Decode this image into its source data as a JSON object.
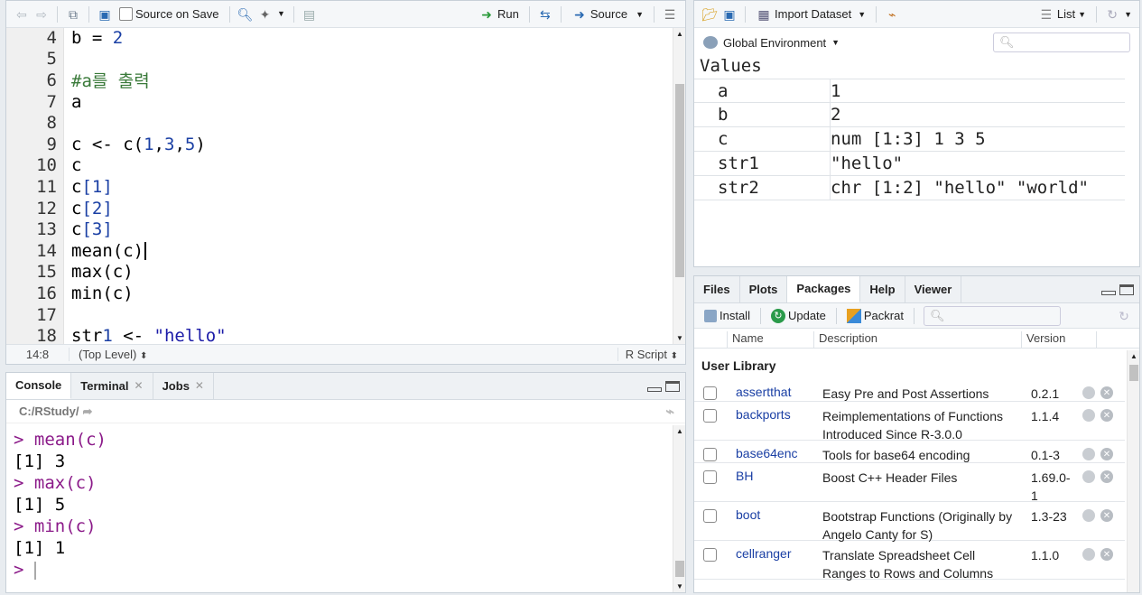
{
  "editor": {
    "toolbar": {
      "source_on_save": "Source on Save",
      "run": "Run",
      "source": "Source"
    },
    "lines": [
      {
        "n": "4",
        "code": "b = 2"
      },
      {
        "n": "5",
        "code": ""
      },
      {
        "n": "6",
        "code": "#a를 출력"
      },
      {
        "n": "7",
        "code": "a"
      },
      {
        "n": "8",
        "code": ""
      },
      {
        "n": "9",
        "code": "c <- c(1,3,5)"
      },
      {
        "n": "10",
        "code": "c"
      },
      {
        "n": "11",
        "code": "c[1]"
      },
      {
        "n": "12",
        "code": "c[2]"
      },
      {
        "n": "13",
        "code": "c[3]"
      },
      {
        "n": "14",
        "code": "mean(c)"
      },
      {
        "n": "15",
        "code": "max(c)"
      },
      {
        "n": "16",
        "code": "min(c)"
      },
      {
        "n": "17",
        "code": ""
      },
      {
        "n": "18",
        "code": "str1 <- \"hello\""
      }
    ],
    "status": {
      "position": "14:8",
      "scope": "(Top Level)",
      "filetype": "R Script"
    }
  },
  "console": {
    "tabs": [
      "Console",
      "Terminal",
      "Jobs"
    ],
    "path": "C:/RStudy/",
    "lines": [
      {
        "kind": "cmd",
        "text": "> mean(c)"
      },
      {
        "kind": "out",
        "text": "[1] 3"
      },
      {
        "kind": "cmd",
        "text": "> max(c)"
      },
      {
        "kind": "out",
        "text": "[1] 5"
      },
      {
        "kind": "cmd",
        "text": "> min(c)"
      },
      {
        "kind": "out",
        "text": "[1] 1"
      },
      {
        "kind": "cmd",
        "text": "> "
      }
    ]
  },
  "environment": {
    "toolbar": {
      "import": "Import Dataset",
      "list": "List"
    },
    "scope": "Global Environment",
    "section": "Values",
    "rows": [
      {
        "name": "a",
        "value": "1"
      },
      {
        "name": "b",
        "value": "2"
      },
      {
        "name": "c",
        "value": "num [1:3] 1 3 5"
      },
      {
        "name": "str1",
        "value": "\"hello\""
      },
      {
        "name": "str2",
        "value": "chr [1:2] \"hello\" \"world\""
      }
    ]
  },
  "files_pane": {
    "tabs": [
      "Files",
      "Plots",
      "Packages",
      "Help",
      "Viewer"
    ],
    "toolbar": {
      "install": "Install",
      "update": "Update",
      "packrat": "Packrat"
    },
    "columns": {
      "name": "Name",
      "description": "Description",
      "version": "Version"
    },
    "section": "User Library",
    "packages": [
      {
        "name": "assertthat",
        "desc": "Easy Pre and Post Assertions",
        "ver": "0.2.1"
      },
      {
        "name": "backports",
        "desc": "Reimplementations of Functions Introduced Since R-3.0.0",
        "ver": "1.1.4"
      },
      {
        "name": "base64enc",
        "desc": "Tools for base64 encoding",
        "ver": "0.1-3"
      },
      {
        "name": "BH",
        "desc": "Boost C++ Header Files",
        "ver": "1.69.0-1"
      },
      {
        "name": "boot",
        "desc": "Bootstrap Functions (Originally by Angelo Canty for S)",
        "ver": "1.3-23"
      },
      {
        "name": "cellranger",
        "desc": "Translate Spreadsheet Cell Ranges to Rows and Columns",
        "ver": "1.1.0"
      }
    ]
  },
  "colors": {
    "accent": "#1a3fa4",
    "console_cmd": "#8b1a89",
    "number": "#1a3fa4",
    "string": "#1c1ca8",
    "comment": "#3a7a3a"
  }
}
